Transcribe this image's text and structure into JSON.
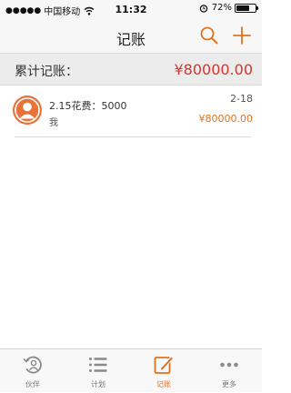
{
  "status_bar": {
    "signal": "●●●●●",
    "carrier": "中国移动",
    "time": "11:32",
    "battery_percent": "72%",
    "battery_level": 0.72
  },
  "nav": {
    "title": "记账",
    "search_icon": "search-icon",
    "add_icon": "plus-icon"
  },
  "summary": {
    "label": "累计记账：",
    "value": "¥80000.00"
  },
  "records": [
    {
      "title": "2.15花费：5000",
      "user": "我",
      "date": "2-18",
      "amount": "¥80000.00"
    }
  ],
  "tabs": [
    {
      "label": "伙伴",
      "icon": "partner-icon"
    },
    {
      "label": "计划",
      "icon": "list-icon"
    },
    {
      "label": "记账",
      "icon": "edit-icon"
    },
    {
      "label": "更多",
      "icon": "more-icon"
    }
  ],
  "colors": {
    "accent": "#e2711d",
    "total": "#d9332b"
  }
}
